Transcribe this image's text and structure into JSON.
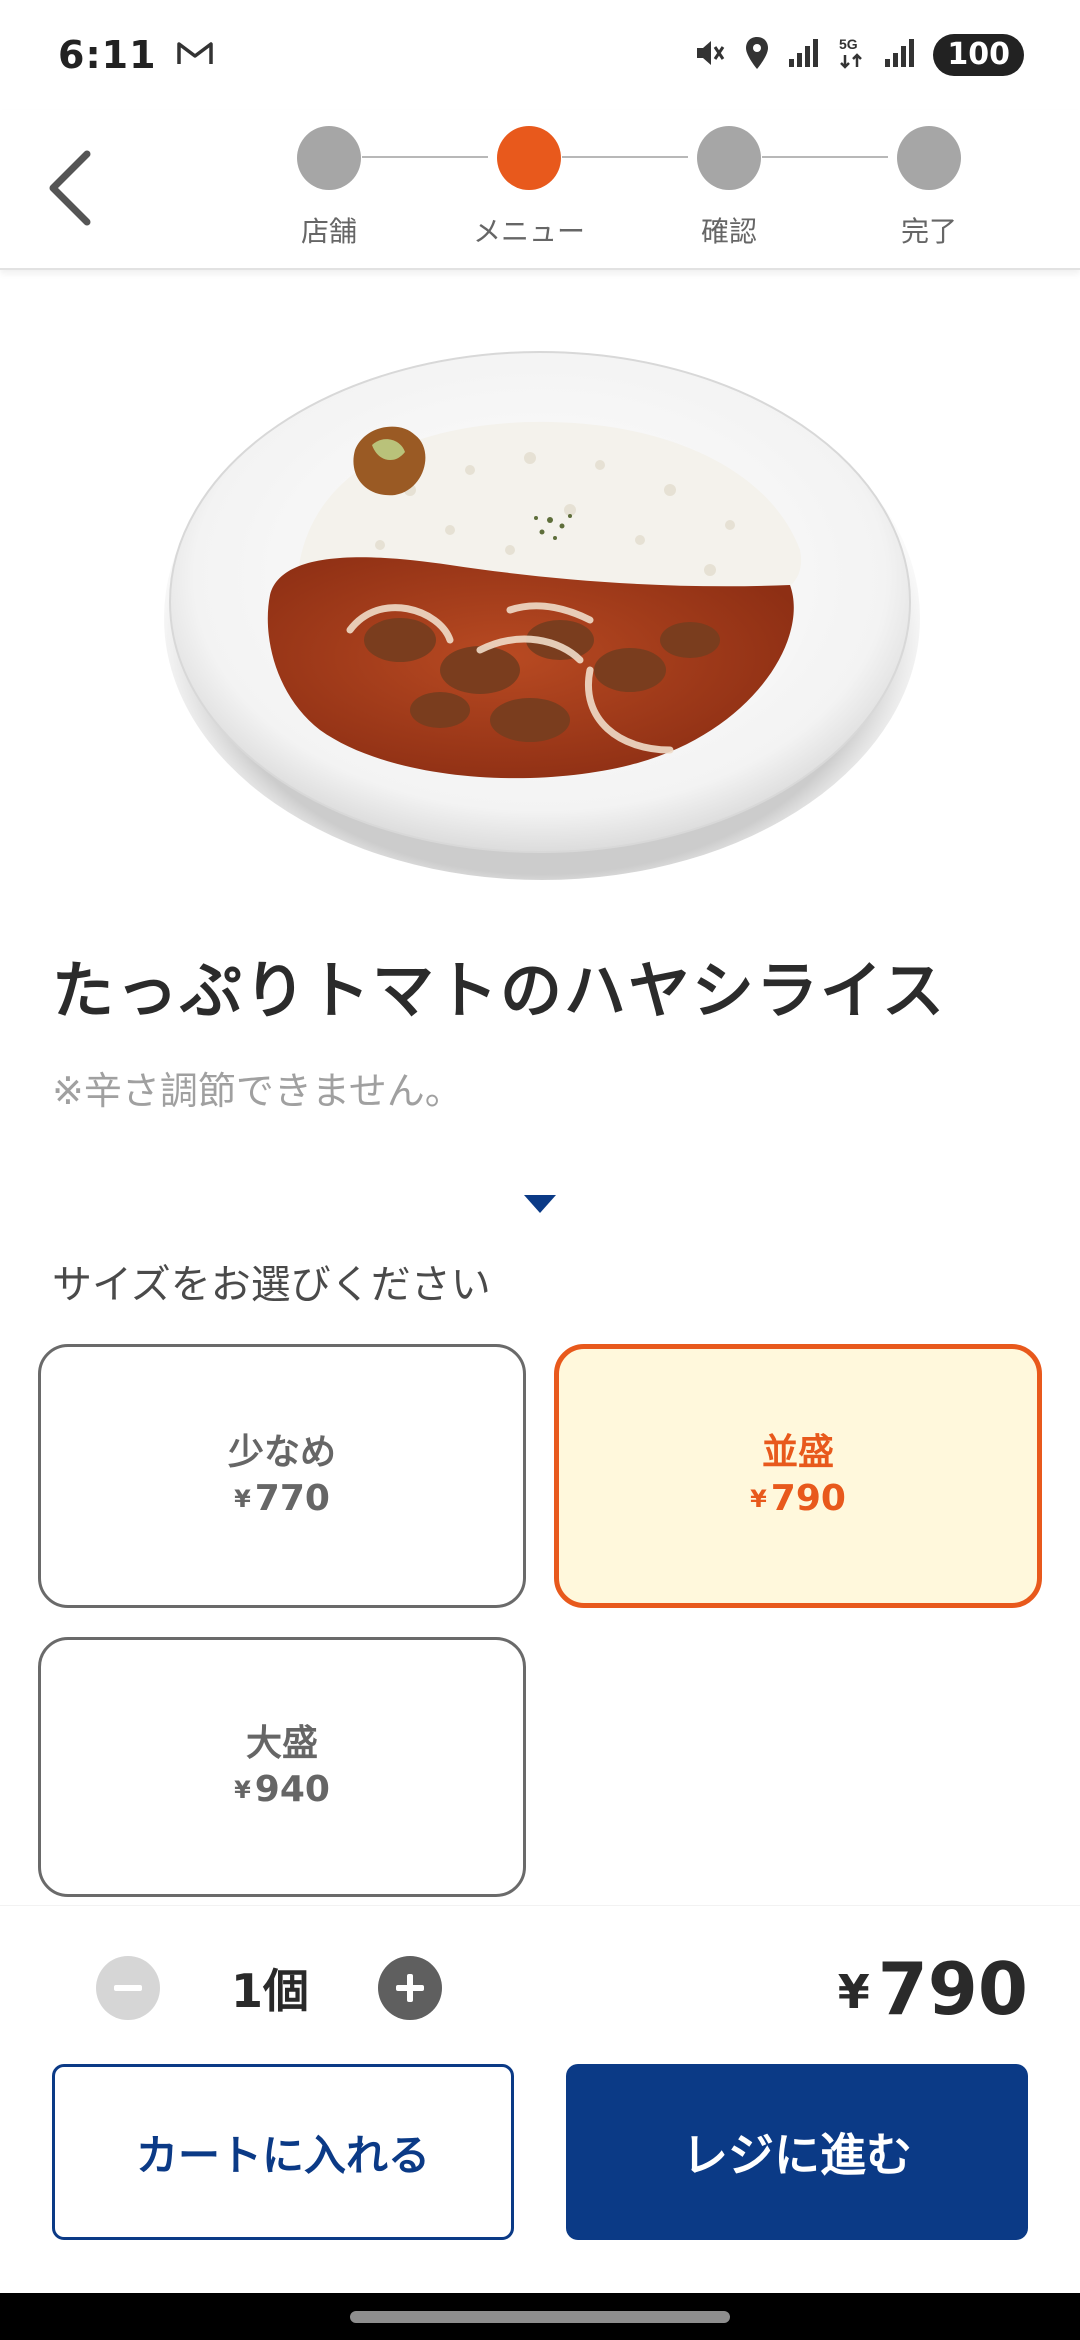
{
  "status_bar": {
    "time": "6:11",
    "battery": "100",
    "icons": [
      "gmail-icon",
      "mute-icon",
      "location-icon",
      "signal-icon",
      "5g-icon",
      "signal-icon"
    ]
  },
  "progress": {
    "steps": [
      {
        "label": "店舗",
        "active": false
      },
      {
        "label": "メニュー",
        "active": true
      },
      {
        "label": "確認",
        "active": false
      },
      {
        "label": "完了",
        "active": false
      }
    ]
  },
  "product": {
    "name": "たっぷりトマトのハヤシライス",
    "note": "※辛さ調節できません。"
  },
  "size_section": {
    "prompt": "サイズをお選びください",
    "options": [
      {
        "name": "少なめ",
        "currency": "¥",
        "price": "770",
        "selected": false
      },
      {
        "name": "並盛",
        "currency": "¥",
        "price": "790",
        "selected": true
      },
      {
        "name": "大盛",
        "currency": "¥",
        "price": "940",
        "selected": false
      }
    ]
  },
  "order": {
    "quantity": "1個",
    "currency": "¥",
    "total": "790",
    "add_to_cart_label": "カートに入れる",
    "checkout_label": "レジに進む"
  },
  "colors": {
    "accent": "#e8591c",
    "primary": "#0b3a86",
    "selected_bg": "#fff8dc",
    "step_inactive": "#a6a6a6"
  }
}
